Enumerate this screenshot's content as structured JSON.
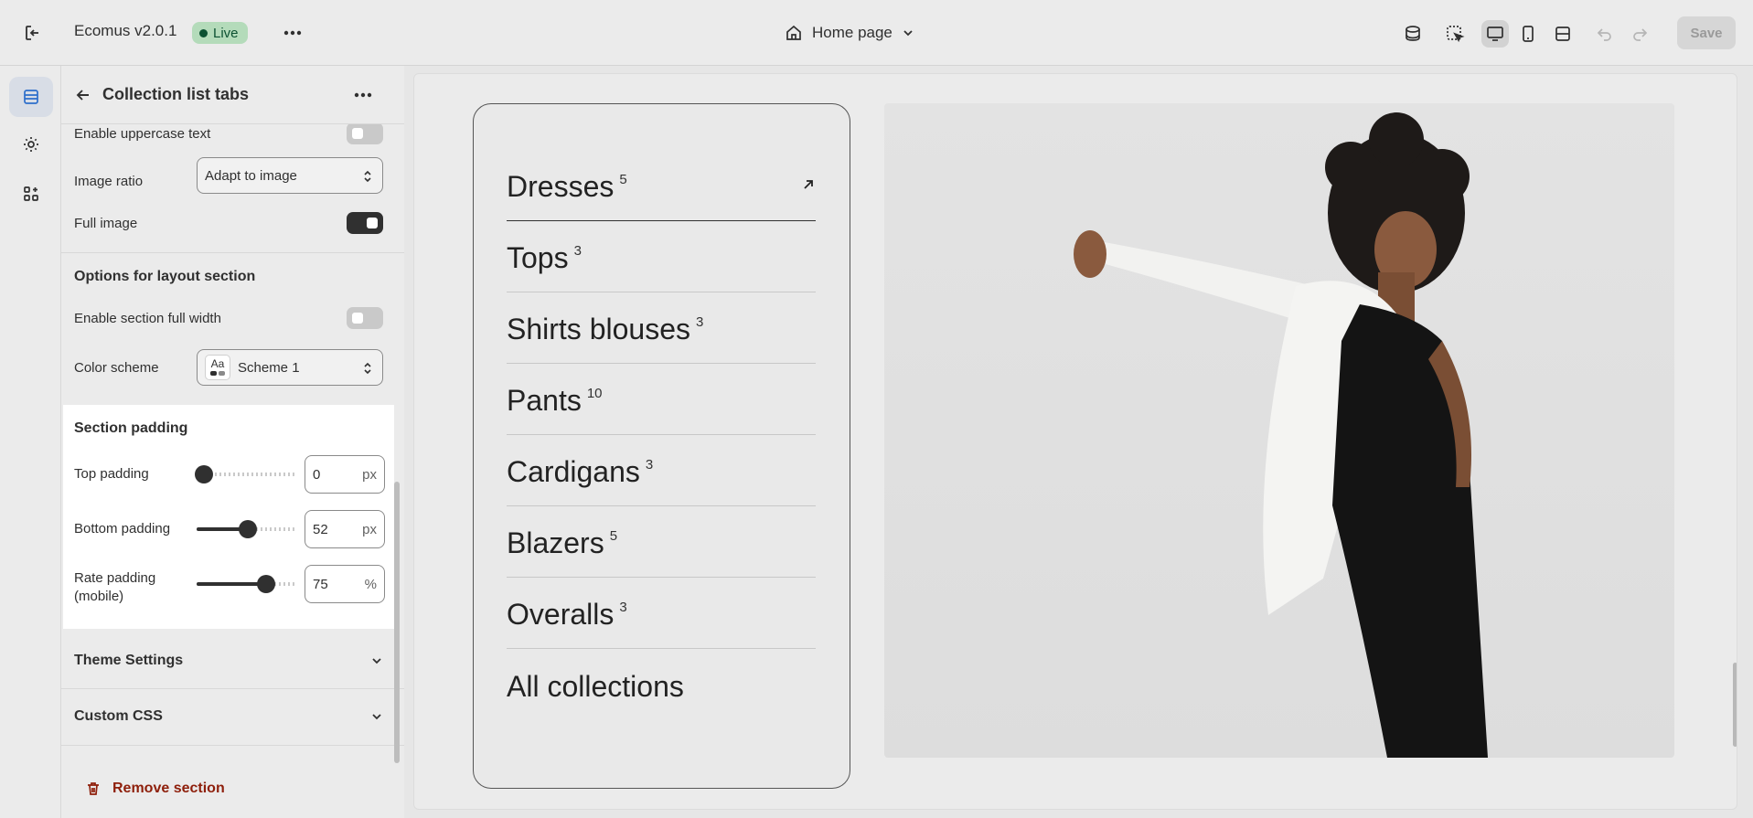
{
  "topbar": {
    "app_title": "Ecomus v2.0.1",
    "status_badge": "Live",
    "page_selector": "Home page",
    "save_label": "Save"
  },
  "panel": {
    "title": "Collection list tabs",
    "rows": {
      "uppercase": "Enable uppercase text",
      "image_ratio_label": "Image ratio",
      "image_ratio_value": "Adapt to image",
      "full_image": "Full image",
      "layout_group": "Options for layout section",
      "full_width": "Enable section full width",
      "color_scheme_label": "Color scheme",
      "color_scheme_value": "Scheme 1",
      "scheme_swatch": "Aa"
    },
    "padding": {
      "title": "Section padding",
      "top_label": "Top padding",
      "top_value": "0",
      "top_unit": "px",
      "bottom_label": "Bottom padding",
      "bottom_value": "52",
      "bottom_unit": "px",
      "rate_label_1": "Rate padding",
      "rate_label_2": "(mobile)",
      "rate_value": "75",
      "rate_unit": "%"
    },
    "theme_settings": "Theme Settings",
    "custom_css": "Custom CSS",
    "remove_section": "Remove section"
  },
  "preview": {
    "collections": [
      {
        "name": "Dresses",
        "count": "5"
      },
      {
        "name": "Tops",
        "count": "3"
      },
      {
        "name": "Shirts blouses",
        "count": "3"
      },
      {
        "name": "Pants",
        "count": "10"
      },
      {
        "name": "Cardigans",
        "count": "3"
      },
      {
        "name": "Blazers",
        "count": "5"
      },
      {
        "name": "Overalls",
        "count": "3"
      },
      {
        "name": "All collections",
        "count": ""
      }
    ]
  }
}
